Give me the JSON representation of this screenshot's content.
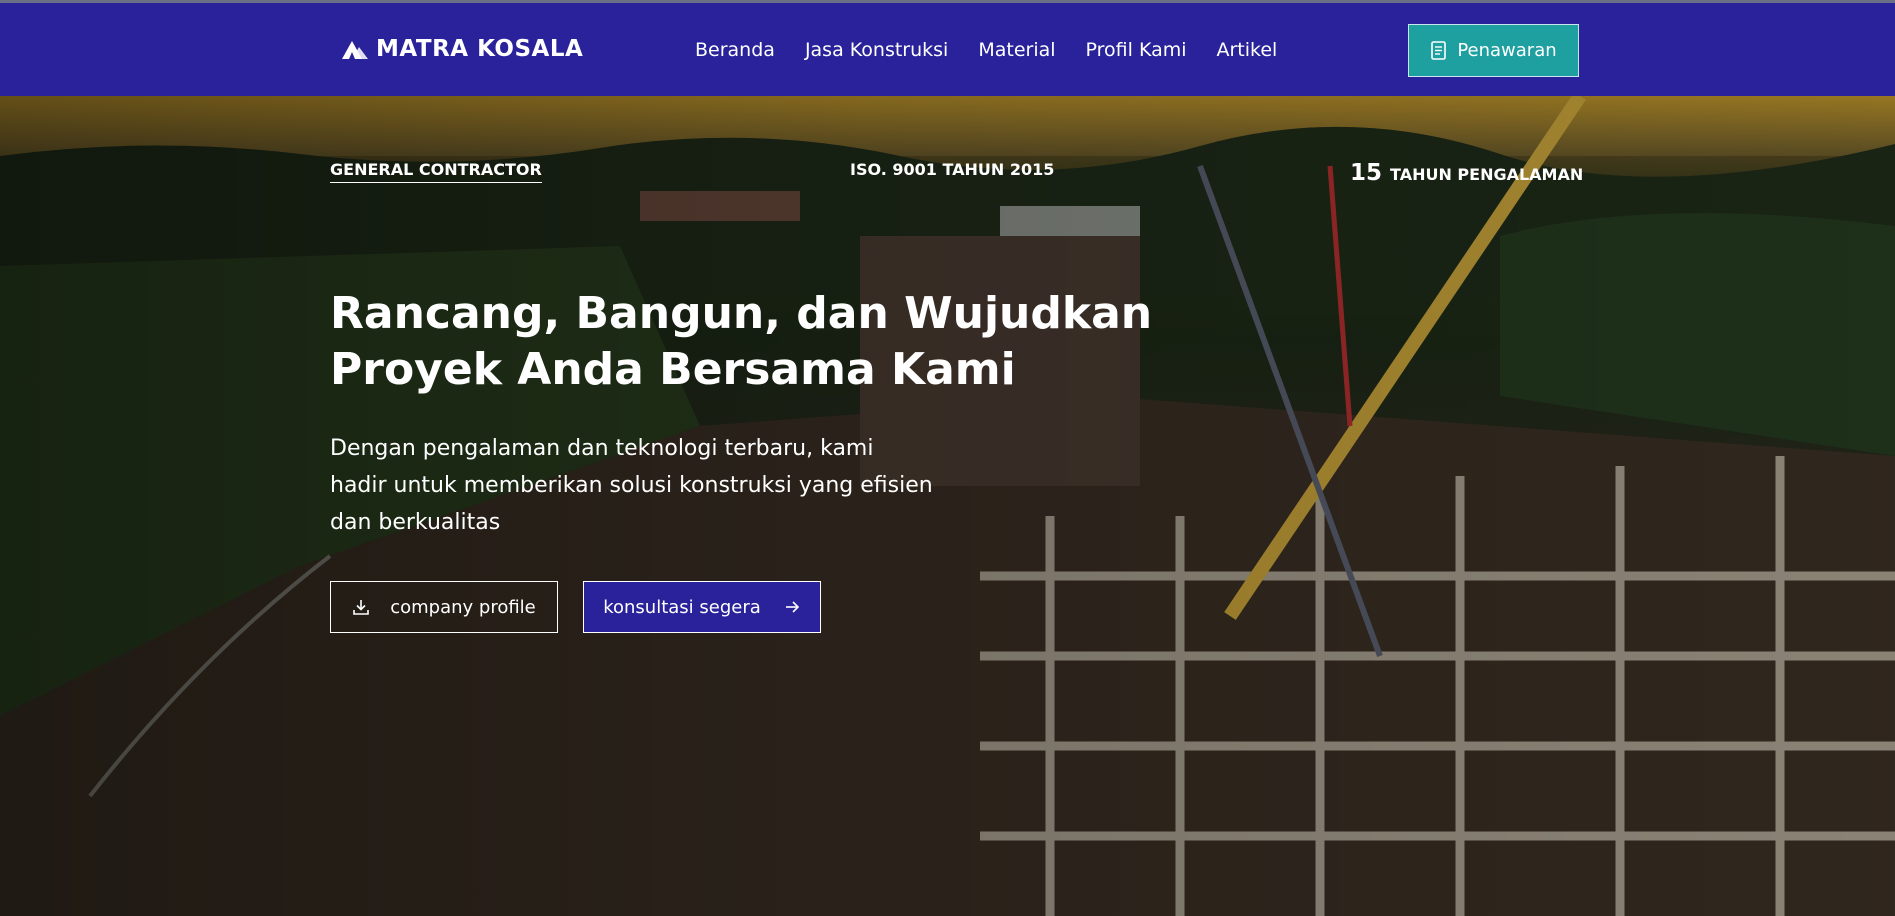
{
  "brand": {
    "name": "MATRA KOSALA",
    "logo_icon": "mountain-logo-icon"
  },
  "nav": {
    "items": [
      {
        "label": "Beranda"
      },
      {
        "label": "Jasa Konstruksi"
      },
      {
        "label": "Material"
      },
      {
        "label": "Profil Kami"
      },
      {
        "label": "Artikel"
      }
    ],
    "cta": {
      "label": "Penawaran",
      "icon": "document-icon"
    }
  },
  "hero": {
    "badges": {
      "left": "GENERAL CONTRACTOR",
      "middle": "ISO. 9001 TAHUN 2015",
      "right_number": "15",
      "right_label": "TAHUN PENGALAMAN"
    },
    "headline_line1": "Rancang, Bangun, dan Wujudkan",
    "headline_line2": "Proyek Anda Bersama Kami",
    "subtext_line1": "Dengan pengalaman dan teknologi terbaru, kami",
    "subtext_line2": "hadir untuk memberikan solusi konstruksi yang efisien",
    "subtext_line3": "dan berkualitas",
    "buttons": {
      "profile": {
        "label": "company profile",
        "icon": "download-icon"
      },
      "consult": {
        "label": "konsultasi segera",
        "icon": "arrow-right-icon"
      }
    }
  },
  "colors": {
    "navbar_bg": "#2a229a",
    "cta_bg": "#1fa0a0",
    "text": "#ffffff"
  }
}
